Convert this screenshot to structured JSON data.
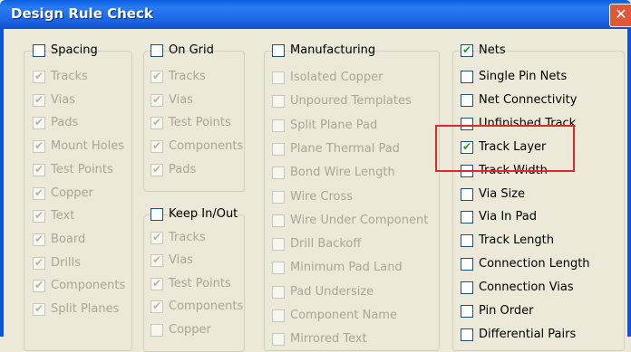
{
  "window": {
    "title": "Design Rule Check",
    "close_symbol": "✕"
  },
  "groups": {
    "spacing": {
      "label": "Spacing",
      "checked": false,
      "items": [
        {
          "label": "Tracks",
          "checked": true
        },
        {
          "label": "Vias",
          "checked": true
        },
        {
          "label": "Pads",
          "checked": true
        },
        {
          "label": "Mount Holes",
          "checked": true
        },
        {
          "label": "Test Points",
          "checked": true
        },
        {
          "label": "Copper",
          "checked": true
        },
        {
          "label": "Text",
          "checked": true
        },
        {
          "label": "Board",
          "checked": true
        },
        {
          "label": "Drills",
          "checked": true
        },
        {
          "label": "Components",
          "checked": true
        },
        {
          "label": "Split Planes",
          "checked": true
        }
      ]
    },
    "on_grid": {
      "label": "On Grid",
      "checked": false,
      "items": [
        {
          "label": "Tracks",
          "checked": true
        },
        {
          "label": "Vias",
          "checked": true
        },
        {
          "label": "Test Points",
          "checked": true
        },
        {
          "label": "Components",
          "checked": true
        },
        {
          "label": "Pads",
          "checked": true
        }
      ]
    },
    "keep_in_out": {
      "label": "Keep In/Out",
      "checked": false,
      "items": [
        {
          "label": "Tracks",
          "checked": true
        },
        {
          "label": "Vias",
          "checked": true
        },
        {
          "label": "Test Points",
          "checked": true
        },
        {
          "label": "Components",
          "checked": true
        },
        {
          "label": "Copper",
          "checked": false
        }
      ]
    },
    "manufacturing": {
      "label": "Manufacturing",
      "checked": false,
      "items": [
        {
          "label": "Isolated Copper",
          "checked": false
        },
        {
          "label": "Unpoured Templates",
          "checked": false
        },
        {
          "label": "Split Plane Pad",
          "checked": false
        },
        {
          "label": "Plane Thermal Pad",
          "checked": false
        },
        {
          "label": "Bond Wire Length",
          "checked": false
        },
        {
          "label": "Wire Cross",
          "checked": false
        },
        {
          "label": "Wire Under Component",
          "checked": false
        },
        {
          "label": "Drill Backoff",
          "checked": false
        },
        {
          "label": "Minimum Pad Land",
          "checked": false
        },
        {
          "label": "Pad Undersize",
          "checked": false
        },
        {
          "label": "Component Name",
          "checked": false
        },
        {
          "label": "Mirrored Text",
          "checked": false
        }
      ]
    },
    "nets": {
      "label": "Nets",
      "checked": true,
      "items": [
        {
          "label": "Single Pin Nets",
          "checked": false
        },
        {
          "label": "Net Connectivity",
          "checked": false
        },
        {
          "label": "Unfinished Track",
          "checked": false
        },
        {
          "label": "Track Layer",
          "checked": true
        },
        {
          "label": "Track Width",
          "checked": false
        },
        {
          "label": "Via Size",
          "checked": false
        },
        {
          "label": "Via In Pad",
          "checked": false
        },
        {
          "label": "Track Length",
          "checked": false
        },
        {
          "label": "Connection Length",
          "checked": false
        },
        {
          "label": "Connection Vias",
          "checked": false
        },
        {
          "label": "Pin Order",
          "checked": false
        },
        {
          "label": "Differential Pairs",
          "checked": false
        }
      ]
    }
  },
  "colors": {
    "title_bar": "#1c66e6",
    "dialog_bg": "#ece9d8",
    "highlight": "#e3262a",
    "checkmark": "#21a121"
  }
}
